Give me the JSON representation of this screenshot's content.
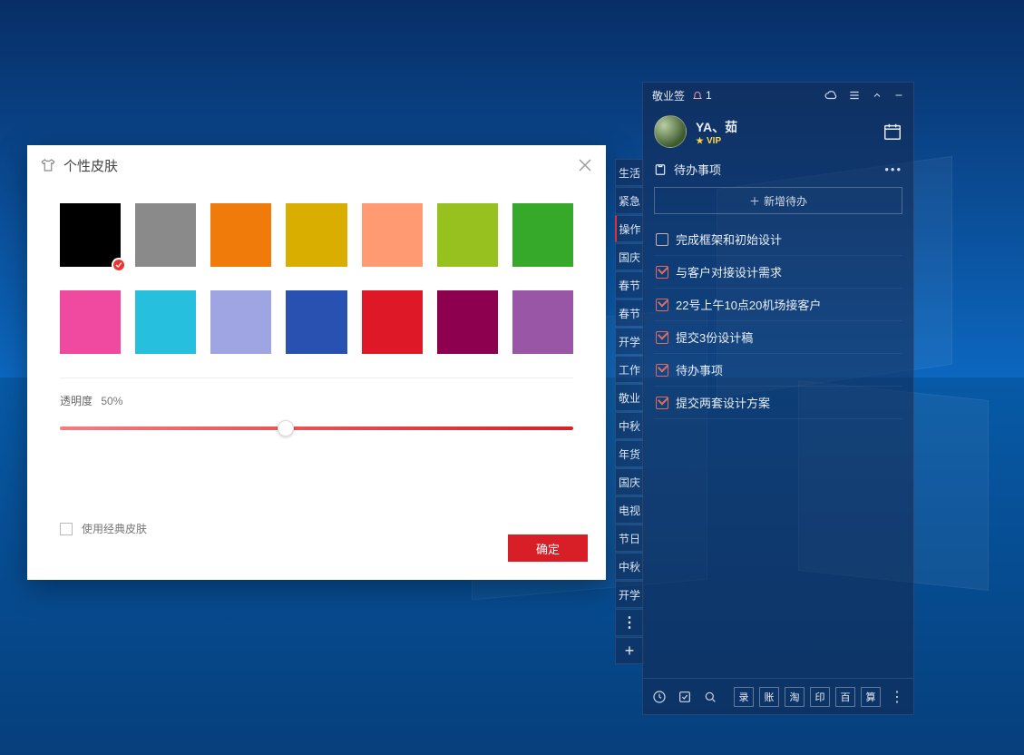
{
  "skin_dialog": {
    "title": "个性皮肤",
    "swatches_row1": [
      "#000000",
      "#8a8a8a",
      "#f07b0a",
      "#d9ae00",
      "#ff9a73",
      "#97c11f",
      "#36a82a"
    ],
    "swatches_row2": [
      "#ef4aa0",
      "#26bfdd",
      "#9fa4e3",
      "#2851b1",
      "#de1826",
      "#8c004f",
      "#9a56a6"
    ],
    "selected_index": 0,
    "opacity_label": "透明度",
    "opacity_value": "50%",
    "opacity_percent": 44,
    "classic_label": "使用经典皮肤",
    "ok_label": "确定"
  },
  "panel": {
    "app_name": "敬业签",
    "notif_count": "1",
    "user_name": "YA、茹",
    "vip_label": "VIP",
    "section_title": "待办事项",
    "add_todo_label": "新增待办",
    "todos": [
      {
        "done": false,
        "text": "完成框架和初始设计"
      },
      {
        "done": true,
        "text": "与客户对接设计需求"
      },
      {
        "done": true,
        "text": "22号上午10点20机场接客户"
      },
      {
        "done": true,
        "text": "提交3份设计稿"
      },
      {
        "done": true,
        "text": "待办事项"
      },
      {
        "done": true,
        "text": "提交两套设计方案"
      }
    ],
    "footer_squares": [
      "录",
      "账",
      "淘",
      "印",
      "百",
      "算"
    ]
  },
  "side_tabs": {
    "items": [
      "生活",
      "紧急",
      "操作",
      "国庆",
      "春节",
      "春节",
      "开学",
      "工作",
      "敬业",
      "中秋",
      "年货",
      "国庆",
      "电视",
      "节日",
      "中秋",
      "开学"
    ],
    "active_index": 2
  }
}
